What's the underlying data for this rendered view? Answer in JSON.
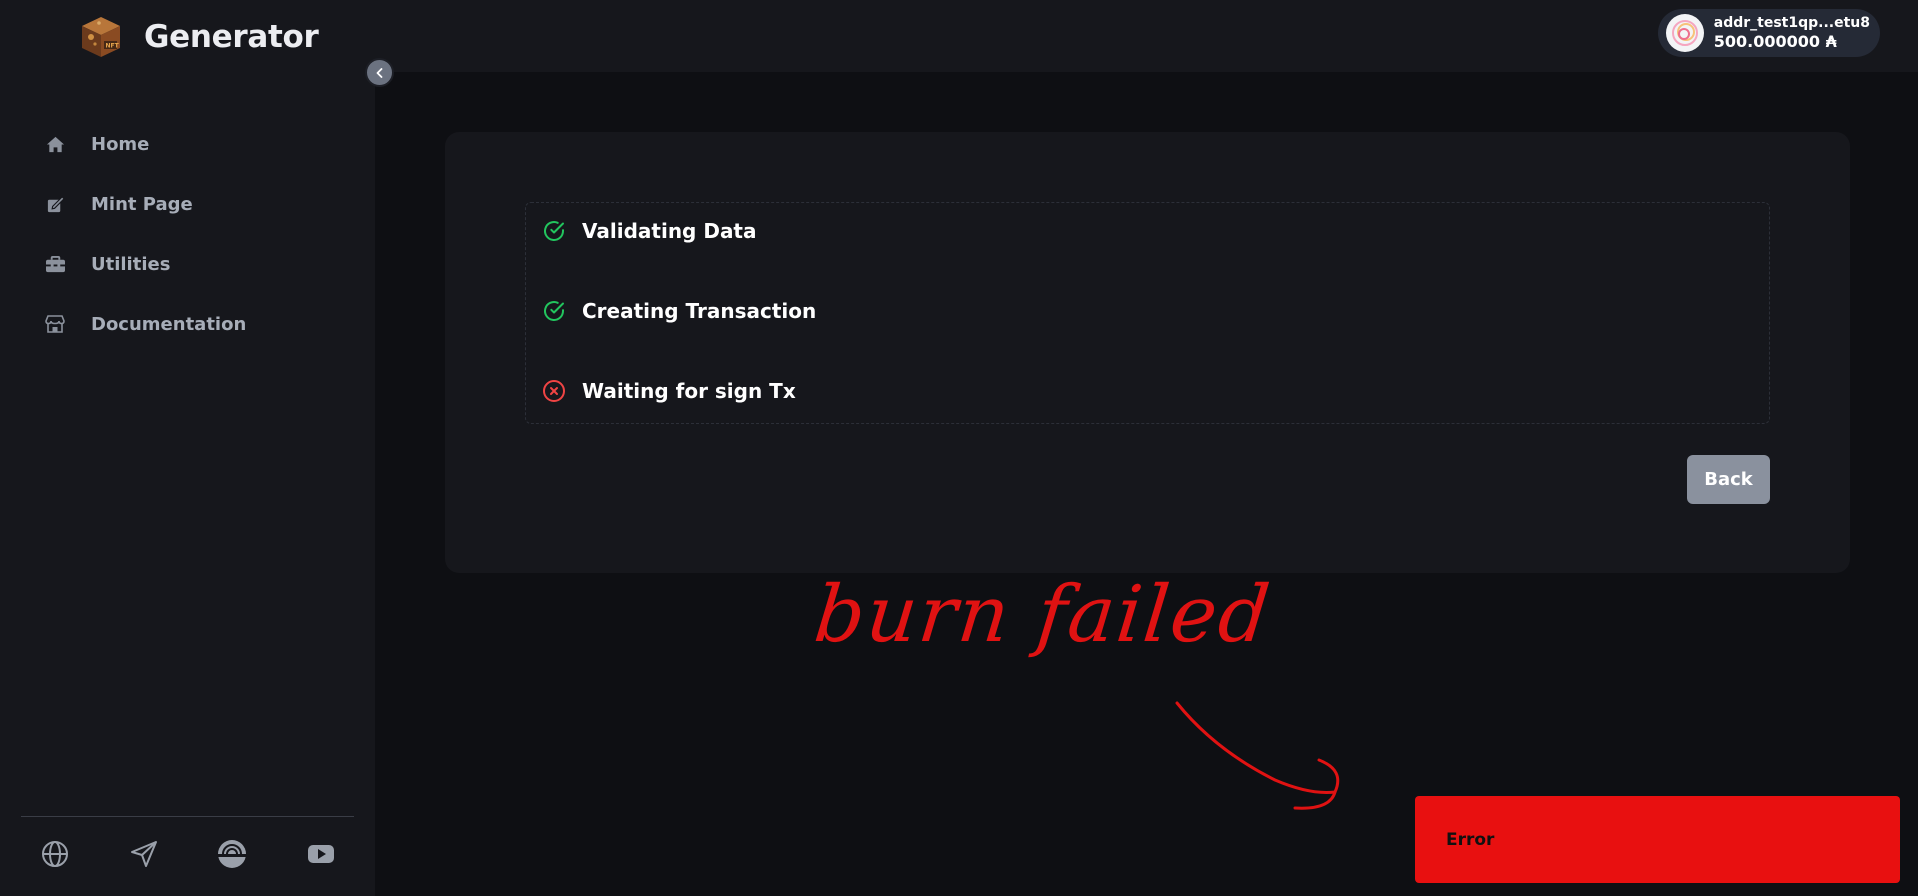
{
  "app": {
    "title": "Generator",
    "logo_icon": "nft-cube-icon"
  },
  "sidebar": {
    "items": [
      {
        "label": "Home",
        "icon": "home-icon"
      },
      {
        "label": "Mint Page",
        "icon": "mint-icon"
      },
      {
        "label": "Utilities",
        "icon": "toolbox-icon"
      },
      {
        "label": "Documentation",
        "icon": "store-icon"
      }
    ],
    "social": [
      "globe-icon",
      "telegram-icon",
      "podcast-icon",
      "youtube-icon"
    ]
  },
  "wallet": {
    "address": "addr_test1qp...etu8",
    "balance": "500.000000 ₳"
  },
  "steps": [
    {
      "label": "Validating Data",
      "status": "success"
    },
    {
      "label": "Creating Transaction",
      "status": "success"
    },
    {
      "label": "Waiting for sign Tx",
      "status": "failed"
    }
  ],
  "card": {
    "back_label": "Back"
  },
  "annotation": {
    "text": "burn failed"
  },
  "toast": {
    "message": "Error"
  },
  "colors": {
    "success": "#22c55e",
    "failed": "#ef4444",
    "toast_bg": "#e81010",
    "annotation": "#e01212"
  }
}
